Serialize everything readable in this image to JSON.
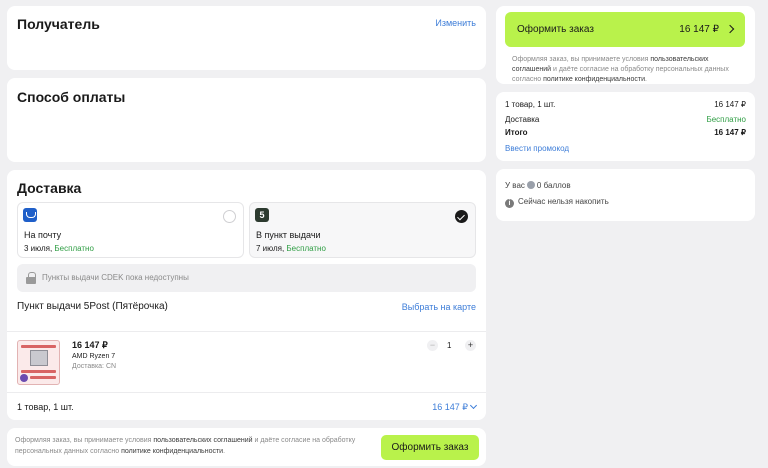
{
  "recipient": {
    "title": "Получатель",
    "change_link": "Изменить"
  },
  "payment": {
    "title": "Способ оплаты"
  },
  "delivery": {
    "title": "Доставка",
    "options": [
      {
        "title": "На почту",
        "date": "3 июля,",
        "price": "Бесплатно",
        "icon": "russian-post-logo",
        "selected": false
      },
      {
        "title": "В пункт выдачи",
        "date": "7 июля,",
        "price": "Бесплатно",
        "icon": "5post-logo",
        "logo_text": "5",
        "selected": true
      }
    ],
    "cdek_notice": "Пункты выдачи CDEK пока недоступны",
    "pickup_point_label": "Пункт выдачи 5Post (Пятёрочка)",
    "map_link": "Выбрать на карте"
  },
  "product": {
    "price": "16 147 ₽",
    "name": "AMD Ryzen 7",
    "shipping": "Доставка: CN",
    "quantity": "1",
    "minus": "−",
    "plus": "+"
  },
  "summary": {
    "count": "1 товар, 1 шт.",
    "total": "16 147 ₽"
  },
  "bottom": {
    "disclaimer_1": "Оформляя заказ, вы принимаете условия ",
    "disclaimer_link1": "пользовательских соглашений",
    "disclaimer_2": " и даёте согласие на обработку персональных данных согласно ",
    "disclaimer_link2": "политике конфиденциальности",
    "disclaimer_end": ".",
    "button": "Оформить заказ"
  },
  "order": {
    "button_label": "Оформить заказ",
    "button_price": "16 147 ₽",
    "disclaimer_1": "Оформляя заказ, вы принимаете условия ",
    "disclaimer_link1": "пользовательских соглашений",
    "disclaimer_2": " и даёте согласие на обработку персональных данных согласно ",
    "disclaimer_link2": "политике конфиденциальности",
    "disclaimer_end": "."
  },
  "totals": {
    "items_label": "1 товар, 1 шт.",
    "items_value": "16 147 ₽",
    "delivery_label": "Доставка",
    "delivery_value": "Бесплатно",
    "total_label": "Итого",
    "total_value": "16 147 ₽",
    "promo_link": "Ввести промокод"
  },
  "bonus": {
    "prefix": "У вас",
    "points": "0 баллов",
    "notice": "Сейчас нельзя накопить"
  },
  "colors": {
    "accent": "#b9f24b",
    "link": "#3d7dd8",
    "success": "#2f9e44",
    "background": "#f0f0f2"
  }
}
